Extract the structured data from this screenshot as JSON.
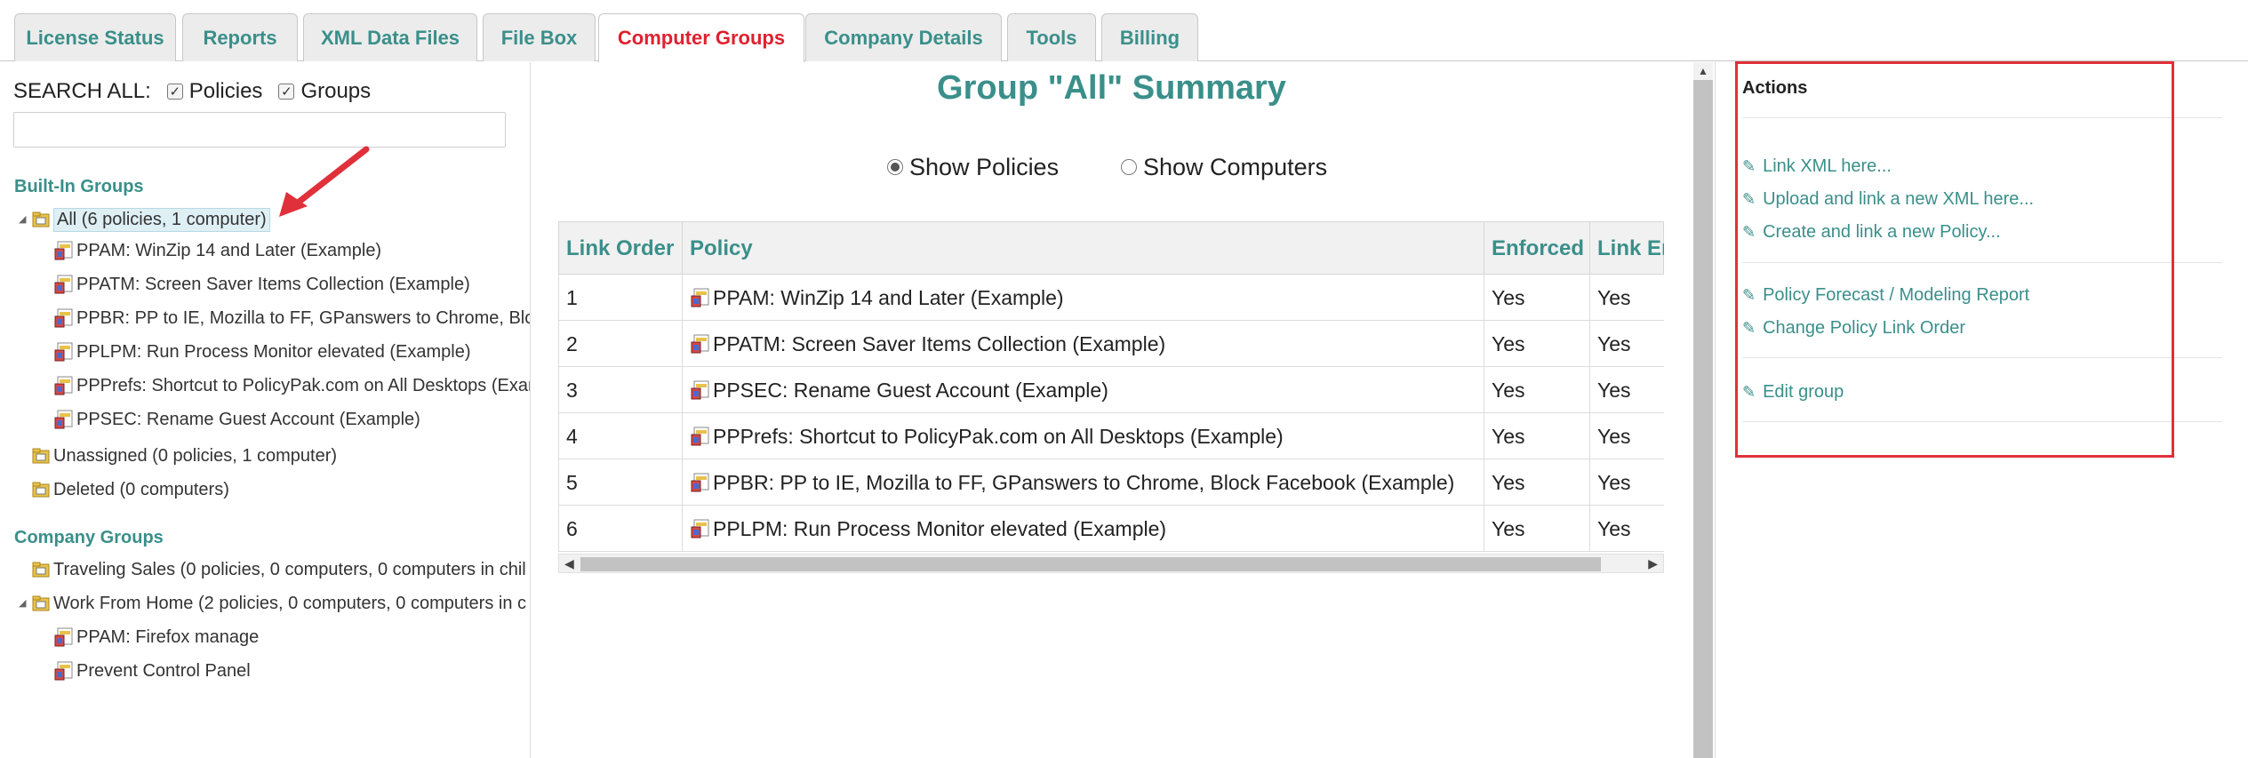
{
  "tabs": [
    {
      "label": "License Status",
      "active": false
    },
    {
      "label": "Reports",
      "active": false
    },
    {
      "label": "XML Data Files",
      "active": false
    },
    {
      "label": "File Box",
      "active": false
    },
    {
      "label": "Computer Groups",
      "active": true
    },
    {
      "label": "Company Details",
      "active": false
    },
    {
      "label": "Tools",
      "active": false
    },
    {
      "label": "Billing",
      "active": false
    }
  ],
  "left": {
    "search_label": "SEARCH ALL:",
    "filters": [
      {
        "label": "Policies",
        "checked": true
      },
      {
        "label": "Groups",
        "checked": true
      }
    ],
    "search_value": "",
    "builtin_heading": "Built-In Groups",
    "builtin_groups": [
      {
        "label": "All (6 policies, 1 computer)",
        "selected": true,
        "expanded": true
      },
      {
        "label": "PPAM: WinZip 14 and Later (Example)"
      },
      {
        "label": "PPATM: Screen Saver Items Collection (Example)"
      },
      {
        "label": "PPBR: PP to IE, Mozilla to FF, GPanswers to Chrome, Block"
      },
      {
        "label": "PPLPM: Run Process Monitor elevated (Example)"
      },
      {
        "label": "PPPrefs: Shortcut to PolicyPak.com on All Desktops (Exam"
      },
      {
        "label": "PPSEC: Rename Guest Account (Example)"
      },
      {
        "label": "Unassigned (0 policies, 1 computer)"
      },
      {
        "label": "Deleted (0 computers)"
      }
    ],
    "company_heading": "Company Groups",
    "company_groups": [
      {
        "label": "Traveling Sales (0 policies, 0 computers, 0 computers in chil"
      },
      {
        "label": "Work From Home (2 policies, 0 computers, 0 computers in c",
        "expanded": true
      },
      {
        "label": "PPAM: Firefox manage"
      },
      {
        "label": "Prevent Control Panel"
      }
    ]
  },
  "summary": {
    "title": "Group \"All\" Summary",
    "radios": [
      {
        "label": "Show Policies",
        "selected": true
      },
      {
        "label": "Show Computers",
        "selected": false
      }
    ],
    "columns": [
      "Link Order",
      "Policy",
      "Enforced",
      "Link En"
    ],
    "rows": [
      {
        "order": "1",
        "policy": "PPAM: WinZip 14 and Later (Example)",
        "enforced": "Yes",
        "link_enabled": "Yes"
      },
      {
        "order": "2",
        "policy": "PPATM: Screen Saver Items Collection (Example)",
        "enforced": "Yes",
        "link_enabled": "Yes"
      },
      {
        "order": "3",
        "policy": "PPSEC: Rename Guest Account (Example)",
        "enforced": "Yes",
        "link_enabled": "Yes"
      },
      {
        "order": "4",
        "policy": "PPPrefs: Shortcut to PolicyPak.com on All Desktops (Example)",
        "enforced": "Yes",
        "link_enabled": "Yes"
      },
      {
        "order": "5",
        "policy": "PPBR: PP to IE, Mozilla to FF, GPanswers to Chrome, Block Facebook (Example)",
        "enforced": "Yes",
        "link_enabled": "Yes"
      },
      {
        "order": "6",
        "policy": "PPLPM: Run Process Monitor elevated (Example)",
        "enforced": "Yes",
        "link_enabled": "Yes"
      }
    ]
  },
  "actions": {
    "title": "Actions",
    "groups": [
      [
        "Link XML here...",
        "Upload and link a new XML here...",
        "Create and link a new Policy..."
      ],
      [
        "Policy Forecast / Modeling Report",
        "Change Policy Link Order"
      ],
      [
        "Edit group"
      ]
    ]
  },
  "colors": {
    "accent": "#3a8f8a",
    "active_tab": "#e0202f",
    "annotation": "#e0303a"
  },
  "icons": {
    "tree_caret": "triangle-expanded-icon",
    "group": "folder-group-icon",
    "policy": "policy-document-icon",
    "action": "pencil-icon",
    "annotation": "red-arrow-annotation"
  }
}
